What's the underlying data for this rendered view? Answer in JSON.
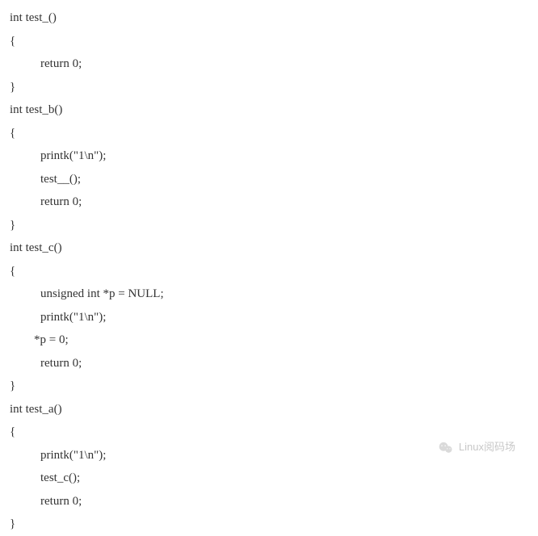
{
  "code": {
    "lines": [
      {
        "text": "int test_()",
        "cls": ""
      },
      {
        "text": "{",
        "cls": ""
      },
      {
        "text": "return 0;",
        "cls": "indent1"
      },
      {
        "text": "}",
        "cls": ""
      },
      {
        "text": "int test_b()",
        "cls": ""
      },
      {
        "text": "{",
        "cls": ""
      },
      {
        "text": "printk(\"1\\n\");",
        "cls": "indent1"
      },
      {
        "text": "test__();",
        "cls": "indent1"
      },
      {
        "text": "return 0;",
        "cls": "indent1"
      },
      {
        "text": "}",
        "cls": ""
      },
      {
        "text": "int test_c()",
        "cls": ""
      },
      {
        "text": "{",
        "cls": ""
      },
      {
        "text": "unsigned int *p = NULL;",
        "cls": "indent1"
      },
      {
        "text": "printk(\"1\\n\");",
        "cls": "indent1"
      },
      {
        "text": "*p = 0;",
        "cls": "indent-star"
      },
      {
        "text": "return 0;",
        "cls": "indent1"
      },
      {
        "text": "}",
        "cls": ""
      },
      {
        "text": "int test_a()",
        "cls": ""
      },
      {
        "text": "{",
        "cls": ""
      },
      {
        "text": "printk(\"1\\n\");",
        "cls": "indent1"
      },
      {
        "text": "test_c();",
        "cls": "indent1"
      },
      {
        "text": "return 0;",
        "cls": "indent1"
      },
      {
        "text": "}",
        "cls": ""
      }
    ]
  },
  "watermark": {
    "text": "Linux阅码场",
    "icon": "wechat-icon"
  }
}
